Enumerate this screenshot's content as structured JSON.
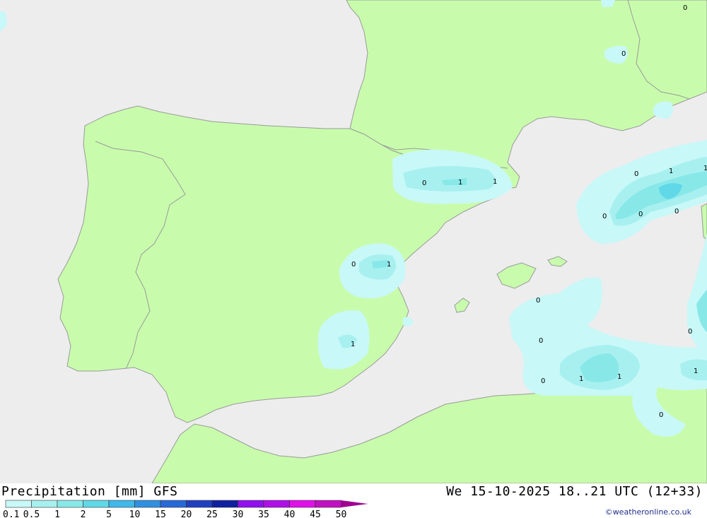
{
  "header": {
    "title": "Precipitation [mm] GFS",
    "timestamp": "We 15-10-2025 18..21 UTC (12+33)",
    "credit": "©weatheronline.co.uk"
  },
  "colors": {
    "sea": "#ededed",
    "land": "#c8fcac",
    "coast": "#9a9a9a"
  },
  "legend": {
    "items": [
      {
        "label": "0.1",
        "color": "#c8f8f8"
      },
      {
        "label": "0.5",
        "color": "#a8f0f0"
      },
      {
        "label": "1",
        "color": "#88e8e8"
      },
      {
        "label": "2",
        "color": "#60d8e8"
      },
      {
        "label": "5",
        "color": "#40b8e8"
      },
      {
        "label": "10",
        "color": "#3090e0"
      },
      {
        "label": "15",
        "color": "#2868d8"
      },
      {
        "label": "20",
        "color": "#2040c0"
      },
      {
        "label": "25",
        "color": "#1020a0"
      },
      {
        "label": "30",
        "color": "#9010f0"
      },
      {
        "label": "35",
        "color": "#b010e8"
      },
      {
        "label": "40",
        "color": "#e010e8"
      },
      {
        "label": "45",
        "color": "#c010c0"
      },
      {
        "label": "50",
        "color": "#a00090"
      }
    ]
  },
  "contour_labels": [
    "0",
    "0",
    "0",
    "1",
    "1",
    "0",
    "1",
    "1",
    "0",
    "0",
    "0",
    "0",
    "1",
    "0",
    "0",
    "0",
    "1",
    "1",
    "0",
    "1",
    "0"
  ]
}
